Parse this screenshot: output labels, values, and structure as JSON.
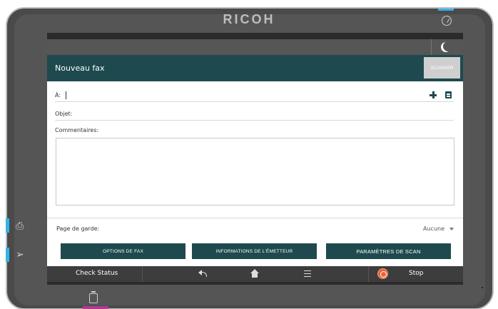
{
  "device": {
    "brand": "RICOH"
  },
  "app": {
    "title": "Nouveau fax",
    "scan_button": "SCANNER"
  },
  "form": {
    "to_label": "À:",
    "subject_label": "Objet:",
    "comments_label": "Commentaires:",
    "comments_value": ""
  },
  "cover_page": {
    "label": "Page de garde:",
    "value": "Aucune"
  },
  "actions": {
    "fax_options": "OPTIONS DE FAX",
    "sender_info": "INFORMATIONS DE L'ÉMETTEUR",
    "scan_params": "PARAMÈTRES DE SCAN"
  },
  "navbar": {
    "check_status": "Check Status",
    "stop": "Stop"
  },
  "icons": {
    "power": "power-icon",
    "sleep": "moon-icon",
    "add_recipient": "plus-icon",
    "address_book": "address-book-icon",
    "back": "back-arrow-icon",
    "home": "home-icon",
    "menu": "menu-icon",
    "stop": "stop-icon",
    "fax": "fax-icon",
    "login": "login-icon",
    "data_in": "data-in-icon"
  },
  "colors": {
    "primary": "#1e4a4f",
    "led": "#33b5e5",
    "stop": "#e8643a"
  }
}
